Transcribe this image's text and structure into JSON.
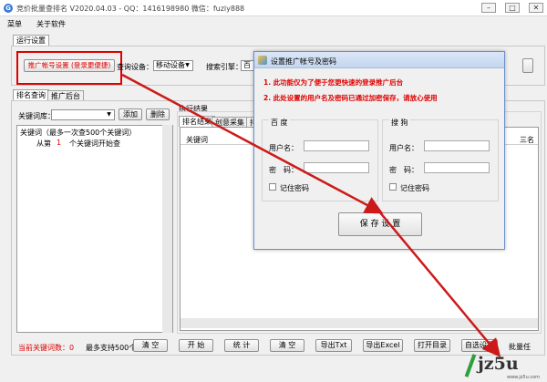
{
  "app": {
    "title": "竞价批量查排名 V2020.04.03 - QQ：1416198980 微信：fuziy888"
  },
  "menu": {
    "items": [
      "菜单",
      "关于软件"
    ]
  },
  "run_settings_tab": "运行设置",
  "top": {
    "promo_button": "推广帐号设置 (登录更便捷)",
    "query_device_label": "查询设备：",
    "query_device_value": "移动设备",
    "search_engine_label": "搜索引擎：",
    "search_engine_value": "百"
  },
  "left_tabs": [
    "排名查询",
    "推广后台"
  ],
  "keyword_lib": {
    "label": "关键词库：",
    "add": "添加",
    "delete": "删除"
  },
  "keywords_box": {
    "title": "关键词（最多一次查500个关键词）",
    "from_label": "从第",
    "from_value": "1",
    "from_suffix": "个关键词开始查"
  },
  "results": {
    "title": "执行结果",
    "tabs": [
      "排名结果",
      "创意采集",
      "排"
    ],
    "column_keyword": "关键词",
    "column_right": "三名"
  },
  "bottom": {
    "current_count": "当前关键词数：0",
    "max_support": "最多支持500个",
    "clear_left": "清 空",
    "start": "开 始",
    "stats": "统 计",
    "clear": "清 空",
    "export_txt": "导出Txt",
    "export_excel": "导出Excel",
    "open_dir": "打开目录",
    "auto_settings": "自选设置",
    "batch": "批量任"
  },
  "dialog": {
    "title": "设置推广帐号及密码",
    "note1": "1. 此功能仅为了便于您更快速的登录推广后台",
    "note2": "2. 此处设置的用户名及密码已通过加密保存，请放心使用",
    "baidu": {
      "name": "百 度",
      "user_label": "用户名：",
      "pass_label": "密　码：",
      "remember": "记住密码"
    },
    "sogou": {
      "name": "搜 狗",
      "user_label": "用户名：",
      "pass_label": "密　码：",
      "remember": "记住密码"
    },
    "save": "保 存 设 置"
  },
  "watermark": {
    "logo": "jz5u",
    "site": "www.jz5u.com"
  },
  "colors": {
    "highlight_red": "#e00000",
    "arrow_red": "#cc1a1a",
    "title_blue": "#c4d6f0"
  }
}
